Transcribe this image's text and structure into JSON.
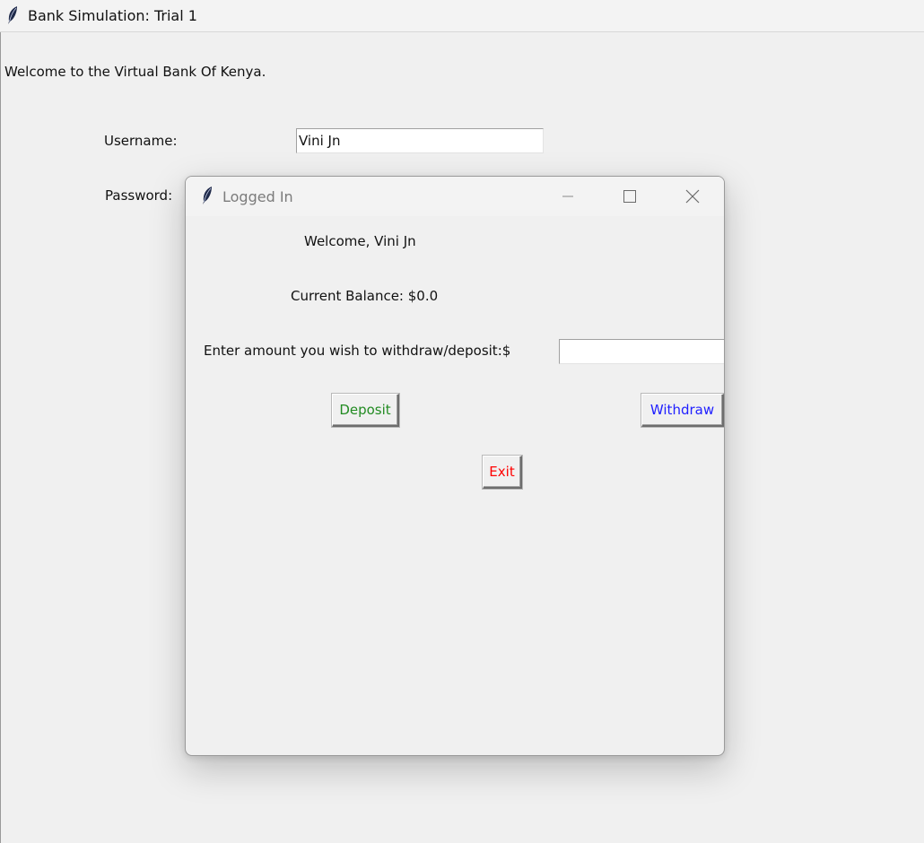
{
  "main_window": {
    "title": "Bank Simulation: Trial 1",
    "welcome": "Welcome to the Virtual Bank Of Kenya.",
    "username_label": "Username:",
    "username_value": "Vini Jn",
    "password_label": "Password:"
  },
  "dialog": {
    "title": "Logged In",
    "greeting": "Welcome, Vini Jn",
    "balance": "Current Balance: $0.0",
    "amount_prompt": "Enter amount you wish to withdraw/deposit:$",
    "amount_value": "",
    "deposit_label": "Deposit",
    "withdraw_label": "Withdraw",
    "exit_label": "Exit"
  },
  "colors": {
    "deposit": "#228b22",
    "withdraw": "#2020ff",
    "exit": "#ff0000",
    "dialog_title": "#7b7b7b",
    "background": "#f0f0f0"
  },
  "icons": [
    "feather-icon",
    "minimize-icon",
    "maximize-icon",
    "close-icon"
  ]
}
